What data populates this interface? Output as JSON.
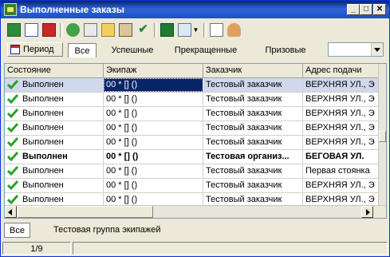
{
  "window": {
    "title": "Выполненные заказы"
  },
  "toolbar": {
    "buttons": [
      "add-order-icon",
      "edit-order-icon",
      "delete-order-icon",
      "refresh-icon",
      "copy-icon",
      "brush-icon",
      "clipboard-icon",
      "confirm-icon",
      "excel-icon",
      "chart-icon",
      "dropdown-arrow-icon",
      "copy-pages-icon",
      "user-icon"
    ]
  },
  "filter": {
    "period_label": "Период",
    "tabs": [
      "Все",
      "Успешные",
      "Прекращенные",
      "Призовые"
    ],
    "active_tab": "Все",
    "combo_value": ""
  },
  "grid": {
    "columns": [
      "Состояние",
      "Экипаж",
      "Заказчик",
      "Адрес подачи"
    ],
    "rows": [
      {
        "status": "Выполнен",
        "crew": "00 * [] ()",
        "customer": "Тестовый заказчик",
        "address": "ВЕРХНЯЯ УЛ., Э",
        "selected": true,
        "bold": false
      },
      {
        "status": "Выполнен",
        "crew": "00 * [] ()",
        "customer": "Тестовый заказчик",
        "address": "ВЕРХНЯЯ УЛ., Э",
        "selected": false,
        "bold": false
      },
      {
        "status": "Выполнен",
        "crew": "00 * [] ()",
        "customer": "Тестовый заказчик",
        "address": "ВЕРХНЯЯ УЛ., Э",
        "selected": false,
        "bold": false
      },
      {
        "status": "Выполнен",
        "crew": "00 * [] ()",
        "customer": "Тестовый заказчик",
        "address": "ВЕРХНЯЯ УЛ., Э",
        "selected": false,
        "bold": false
      },
      {
        "status": "Выполнен",
        "crew": "00 * [] ()",
        "customer": "Тестовый заказчик",
        "address": "ВЕРХНЯЯ УЛ., Э",
        "selected": false,
        "bold": false
      },
      {
        "status": "Выполнен",
        "crew": "00 * [] ()",
        "customer": "Тестовая организ...",
        "address": "БЕГОВАЯ УЛ.",
        "selected": false,
        "bold": true
      },
      {
        "status": "Выполнен",
        "crew": "00 * [] ()",
        "customer": "Тестовый заказчик",
        "address": "Первая стоянка",
        "selected": false,
        "bold": false
      },
      {
        "status": "Выполнен",
        "crew": "00 * [] ()",
        "customer": "Тестовый заказчик",
        "address": "ВЕРХНЯЯ УЛ., Э",
        "selected": false,
        "bold": false
      },
      {
        "status": "Выполнен",
        "crew": "00 * [] ()",
        "customer": "Тестовый заказчик",
        "address": "ВЕРХНЯЯ УЛ., Э",
        "selected": false,
        "bold": false
      }
    ]
  },
  "group_tabs": {
    "items": [
      "Все",
      "Тестовая группа экипажей"
    ],
    "active": "Все"
  },
  "status_bar": {
    "record_position": "1/9"
  }
}
